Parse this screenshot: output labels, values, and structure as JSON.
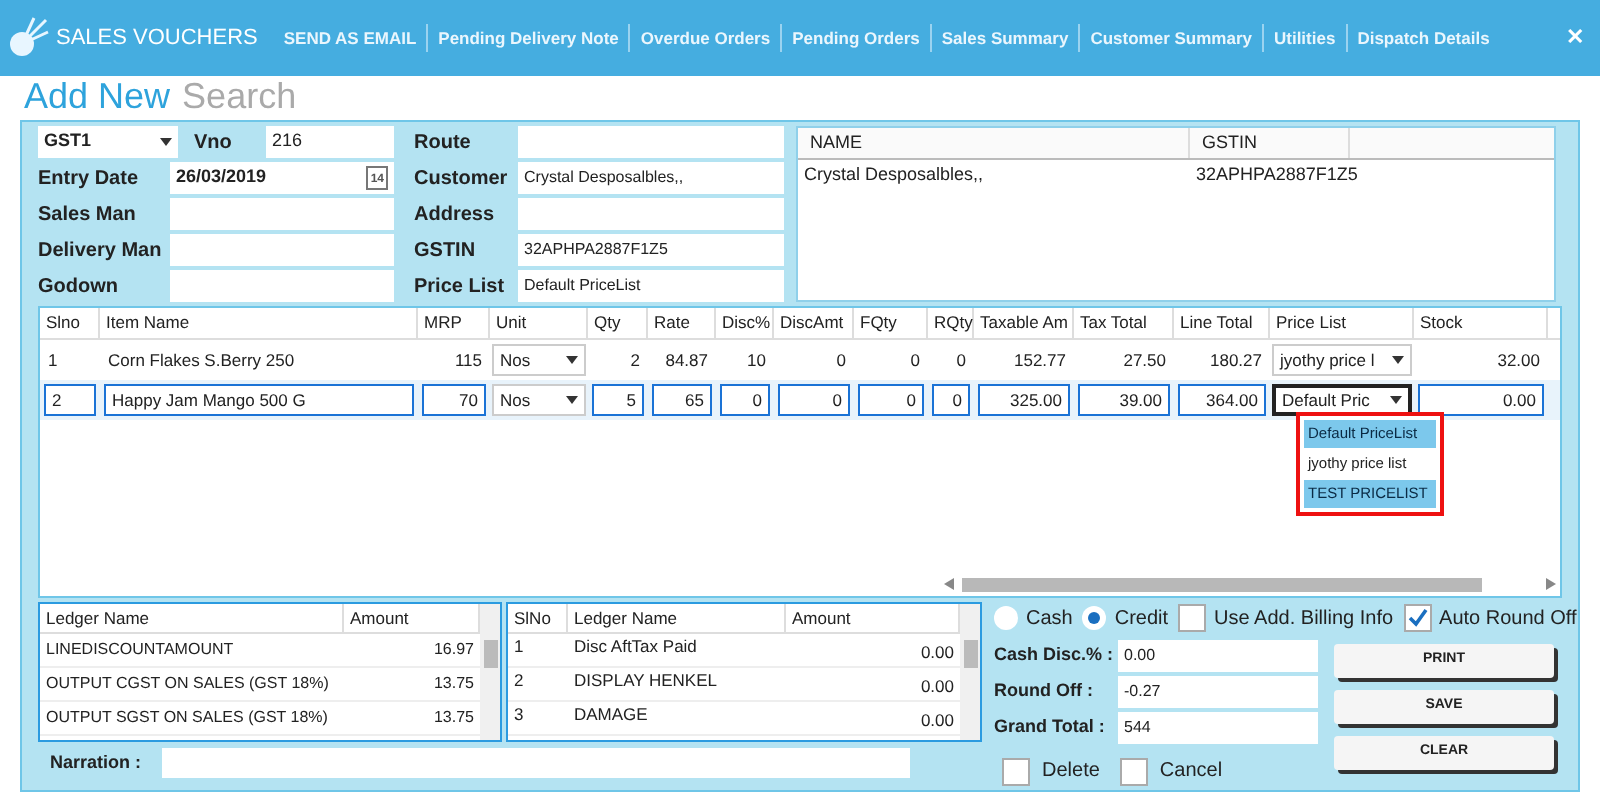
{
  "header": {
    "title": "SALES VOUCHERS",
    "menu": [
      "SEND AS EMAIL",
      "Pending Delivery Note",
      "Overdue Orders",
      "Pending Orders",
      "Sales Summary",
      "Customer Summary",
      "Utilities",
      "Dispatch Details"
    ],
    "close": "✕"
  },
  "mode_tabs": [
    {
      "label": "Add New",
      "selected": true
    },
    {
      "label": "Search",
      "selected": false
    }
  ],
  "form": {
    "series": "GST1",
    "vno_label": "Vno",
    "vno": "216",
    "left_fields": [
      {
        "label": "Entry Date",
        "value": "26/03/2019",
        "kind": "date",
        "calendar": "14"
      },
      {
        "label": "Sales Man",
        "kind": "text"
      },
      {
        "label": "Delivery Man",
        "kind": "text"
      },
      {
        "label": "Godown",
        "kind": "text"
      }
    ],
    "right_fields": [
      {
        "label": "Route"
      },
      {
        "label": "Customer",
        "value": "Crystal Desposalbles,,"
      },
      {
        "label": "Address"
      },
      {
        "label": "GSTIN",
        "value": "32APHPA2887F1Z5"
      },
      {
        "label": "Price List",
        "value": "Default PriceList"
      }
    ]
  },
  "customer_list": {
    "columns": [
      "NAME",
      "GSTIN"
    ],
    "rows": [
      [
        "Crystal Desposalbles,,",
        "32APHPA2887F1Z5"
      ]
    ]
  },
  "items": {
    "columns": [
      {
        "label": "Slno",
        "kind": "text"
      },
      {
        "label": "Item Name",
        "kind": "text"
      },
      {
        "label": "MRP",
        "kind": "number"
      },
      {
        "label": "Unit",
        "kind": "dropdown"
      },
      {
        "label": "Qty",
        "kind": "number"
      },
      {
        "label": "Rate",
        "kind": "number"
      },
      {
        "label": "Disc%",
        "kind": "number"
      },
      {
        "label": "DiscAmt",
        "kind": "number"
      },
      {
        "label": "FQty",
        "kind": "number"
      },
      {
        "label": "RQty",
        "kind": "number"
      },
      {
        "label": "Taxable Am",
        "kind": "number"
      },
      {
        "label": "Tax Total",
        "kind": "number"
      },
      {
        "label": "Line Total",
        "kind": "number"
      },
      {
        "label": "Price List",
        "kind": "dropdown"
      },
      {
        "label": "Stock",
        "kind": "number"
      }
    ],
    "rows": [
      {
        "selected": false,
        "cells": [
          "1",
          "Corn Flakes S.Berry 250",
          "115",
          "Nos",
          "2",
          "84.87",
          "10",
          "0",
          "0",
          "0",
          "152.77",
          "27.50",
          "180.27",
          "jyothy price l",
          "32.00"
        ]
      },
      {
        "selected": true,
        "cells": [
          "2",
          "Happy Jam Mango 500 G",
          "70",
          "Nos",
          "5",
          "65",
          "0",
          "0",
          "0",
          "0",
          "325.00",
          "39.00",
          "364.00",
          "Default Pric",
          "0.00"
        ]
      }
    ],
    "price_options": [
      {
        "label": "Default PriceList",
        "highlighted": true
      },
      {
        "label": "jyothy price list",
        "highlighted": false
      },
      {
        "label": "TEST PRICELIST",
        "highlighted": true
      }
    ]
  },
  "tax_ledger": {
    "columns": [
      "Ledger Name",
      "Amount"
    ],
    "rows": [
      [
        "LINEDISCOUNTAMOUNT",
        "16.97"
      ],
      [
        "OUTPUT CGST ON SALES (GST 18%)",
        "13.75"
      ],
      [
        "OUTPUT SGST ON SALES (GST 18%)",
        "13.75"
      ]
    ]
  },
  "other_ledger": {
    "columns": [
      "SlNo",
      "Ledger Name",
      "Amount"
    ],
    "rows": [
      [
        "1",
        "Disc AftTax Paid",
        "0.00"
      ],
      [
        "2",
        "DISPLAY HENKEL",
        "0.00"
      ],
      [
        "3",
        "DAMAGE",
        "0.00"
      ]
    ]
  },
  "narration": {
    "label": "Narration :"
  },
  "payment": [
    {
      "label": "Cash",
      "selected": false
    },
    {
      "label": "Credit",
      "selected": true
    }
  ],
  "options": [
    {
      "label": "Use Add. Billing Info",
      "checked": false
    },
    {
      "label": "Auto Round Off",
      "checked": true
    }
  ],
  "totals": [
    {
      "label": "Cash Disc.% :",
      "value": "0.00"
    },
    {
      "label": "Round Off :",
      "value": "-0.27"
    },
    {
      "label": "Grand Total :",
      "value": "544"
    }
  ],
  "buttons": [
    "PRINT",
    "SAVE",
    "CLEAR"
  ],
  "flags": [
    {
      "label": "Delete",
      "checked": false
    },
    {
      "label": "Cancel",
      "checked": false
    }
  ]
}
